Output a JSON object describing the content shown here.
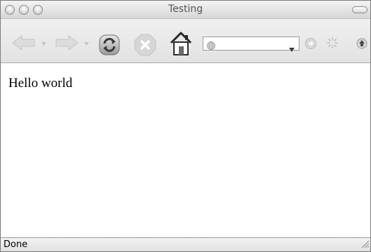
{
  "window": {
    "title": "Testing"
  },
  "toolbar": {
    "back_icon": "back-arrow-icon",
    "forward_icon": "forward-arrow-icon",
    "reload_icon": "reload-icon",
    "stop_icon": "stop-icon",
    "home_icon": "home-icon",
    "address_value": "",
    "go_icon": "go-arrow-icon",
    "activity_icon": "loading-spinner-icon",
    "download_icon": "download-icon"
  },
  "content": {
    "text": "Hello world"
  },
  "statusbar": {
    "text": "Done"
  },
  "colors": {
    "chrome_gray": "#e2e2e2",
    "disabled_icon": "#c8c8c8",
    "reload_green": "#7a9a6a",
    "home_red": "#b04030"
  }
}
